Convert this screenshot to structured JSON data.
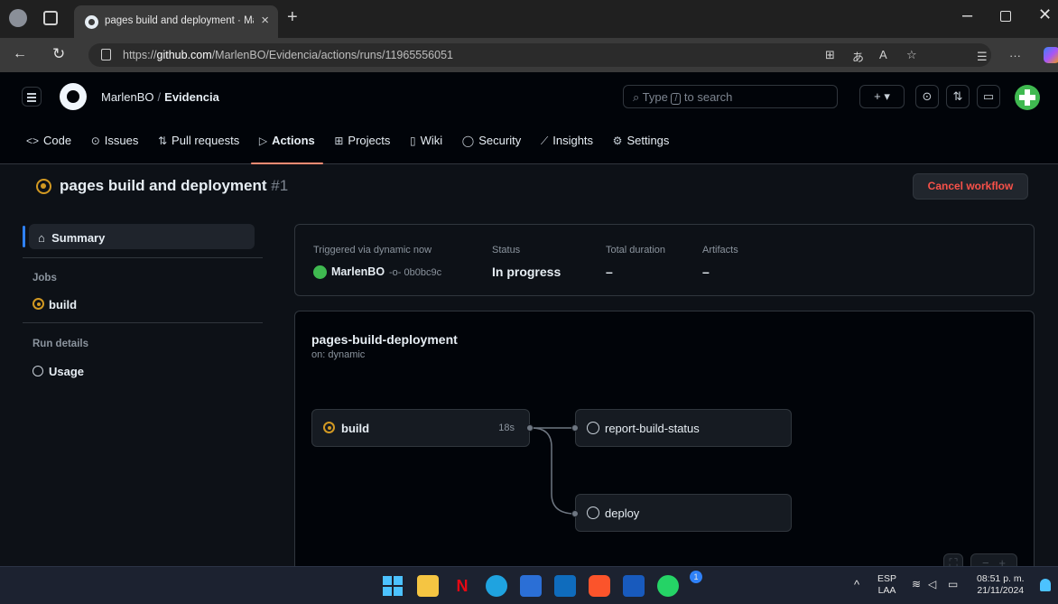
{
  "browser": {
    "tab_title": "pages build and deployment · Ma",
    "tab_close": "×",
    "new_tab": "+",
    "url_prefix": "https://",
    "url_host": "github.com",
    "url_path": "/MarlenBO/Evidencia/actions/runs/11965556051"
  },
  "header": {
    "owner": "MarlenBO",
    "separator": "/",
    "repo": "Evidencia",
    "search_prefix": "Type",
    "search_key": "/",
    "search_suffix": "to search",
    "plus_label": "+ ▾"
  },
  "repo_nav": [
    {
      "icon": "<>",
      "label": "Code"
    },
    {
      "icon": "⊙",
      "label": "Issues"
    },
    {
      "icon": "⇅",
      "label": "Pull requests"
    },
    {
      "icon": "▷",
      "label": "Actions"
    },
    {
      "icon": "⊞",
      "label": "Projects"
    },
    {
      "icon": "▯",
      "label": "Wiki"
    },
    {
      "icon": "◯",
      "label": "Security"
    },
    {
      "icon": "⟋",
      "label": "Insights"
    },
    {
      "icon": "⚙",
      "label": "Settings"
    }
  ],
  "run": {
    "title": "pages build and deployment",
    "number": "#1",
    "cancel_label": "Cancel workflow"
  },
  "sidebar": {
    "summary": "Summary",
    "jobs_heading": "Jobs",
    "job_build": "build",
    "run_details_heading": "Run details",
    "usage": "Usage"
  },
  "summary": {
    "triggered_label": "Triggered via dynamic now",
    "actor": "MarlenBO",
    "commit": "-o- 0b0bc9c",
    "status_label": "Status",
    "status_value": "In progress",
    "duration_label": "Total duration",
    "duration_value": "–",
    "artifacts_label": "Artifacts",
    "artifacts_value": "–"
  },
  "graph": {
    "workflow_name": "pages-build-deployment",
    "trigger": "on: dynamic",
    "jobs": {
      "build": {
        "label": "build",
        "duration": "18s"
      },
      "report": {
        "label": "report-build-status"
      },
      "deploy": {
        "label": "deploy"
      }
    },
    "zoom_minus": "−",
    "zoom_plus": "+"
  },
  "tray": {
    "lang_1": "ESP",
    "lang_2": "LAA",
    "time": "08:51 p. m.",
    "date": "21/11/2024",
    "chevron": "^",
    "notification_count": "1"
  },
  "colors": {
    "in_progress": "#d29922",
    "cancel_text": "#f85149",
    "active_tab_underline": "#fd8c73",
    "accent_blue": "#2f81f7"
  }
}
